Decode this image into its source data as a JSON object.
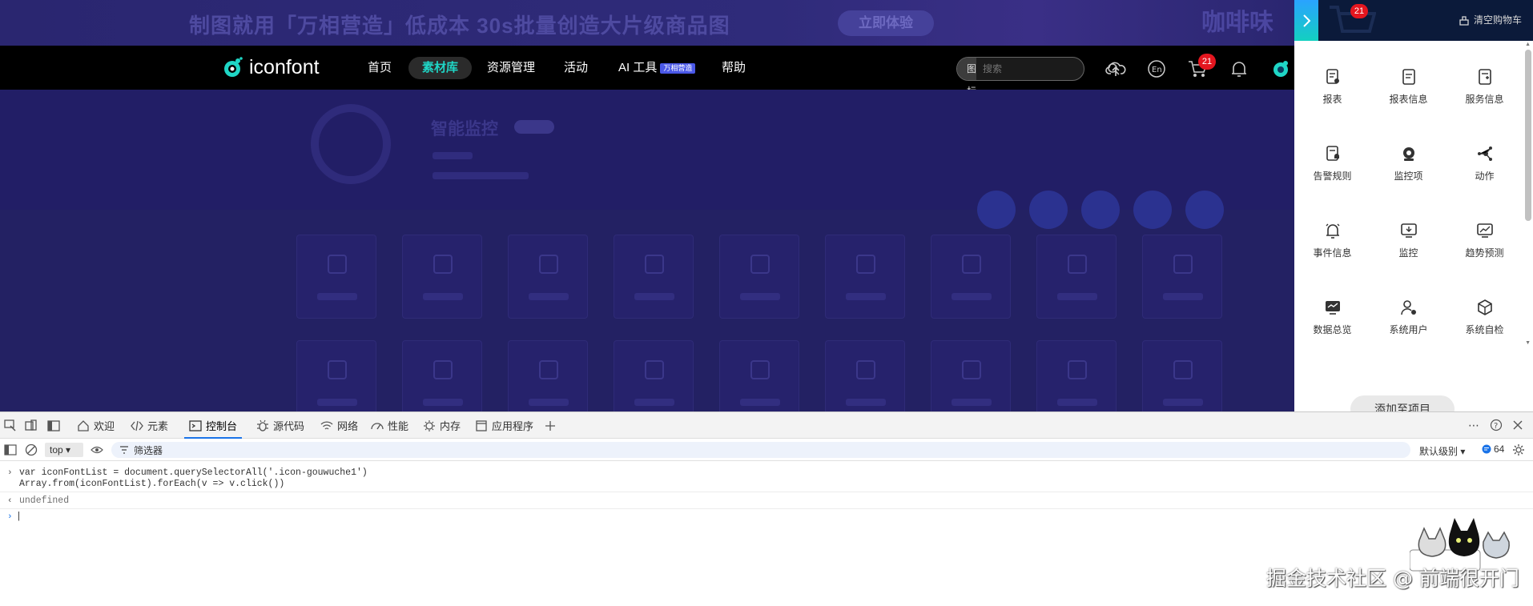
{
  "banner": {
    "text": "制图就用「万相营造」低成本 30s批量创造大片级商品图",
    "button": "立即体验",
    "deco": "咖啡味的"
  },
  "navbar": {
    "logo": "iconfont",
    "items": [
      {
        "label": "首页",
        "active": false
      },
      {
        "label": "素材库",
        "active": true
      },
      {
        "label": "资源管理",
        "active": false
      },
      {
        "label": "活动",
        "active": false
      },
      {
        "label": "AI 工具",
        "active": false,
        "badge": "万相营造"
      },
      {
        "label": "帮助",
        "active": false
      }
    ],
    "search_type": "图标",
    "search_placeholder": "搜索",
    "cart_count": "21"
  },
  "project": {
    "title": "智能监控"
  },
  "panel": {
    "cart_count": "21",
    "clear_label": "清空购物车",
    "items": [
      {
        "label": "报表",
        "icon": "report-icon"
      },
      {
        "label": "报表信息",
        "icon": "report-info-icon"
      },
      {
        "label": "服务信息",
        "icon": "service-info-icon"
      },
      {
        "label": "告警规则",
        "icon": "alarm-rule-icon"
      },
      {
        "label": "监控项",
        "icon": "camera-icon"
      },
      {
        "label": "动作",
        "icon": "share-nodes-icon"
      },
      {
        "label": "事件信息",
        "icon": "bell-icon"
      },
      {
        "label": "监控",
        "icon": "monitor-icon"
      },
      {
        "label": "趋势预测",
        "icon": "trend-icon"
      },
      {
        "label": "数据总览",
        "icon": "dashboard-icon"
      },
      {
        "label": "系统用户",
        "icon": "user-gear-icon"
      },
      {
        "label": "系统自检",
        "icon": "cube-icon"
      }
    ],
    "add_button": "添加至项目"
  },
  "devtools": {
    "tabs": [
      {
        "label": "欢迎",
        "icon": "home-icon"
      },
      {
        "label": "元素",
        "icon": "code-icon"
      },
      {
        "label": "控制台",
        "icon": "console-icon",
        "active": true
      },
      {
        "label": "源代码",
        "icon": "bug-icon"
      },
      {
        "label": "网络",
        "icon": "wifi-icon"
      },
      {
        "label": "性能",
        "icon": "gauge-icon"
      },
      {
        "label": "内存",
        "icon": "chip-icon"
      },
      {
        "label": "应用程序",
        "icon": "app-icon"
      }
    ],
    "context": "top",
    "filter_placeholder": "筛选器",
    "level": "默认级别",
    "issues_count": "64",
    "console": {
      "line1": "var iconFontList = document.querySelectorAll('.icon-gouwuche1')",
      "line2": "Array.from(iconFontList).forEach(v => v.click())",
      "result": "undefined"
    }
  },
  "watermark": "掘金技术社区 @ 前端很开门"
}
